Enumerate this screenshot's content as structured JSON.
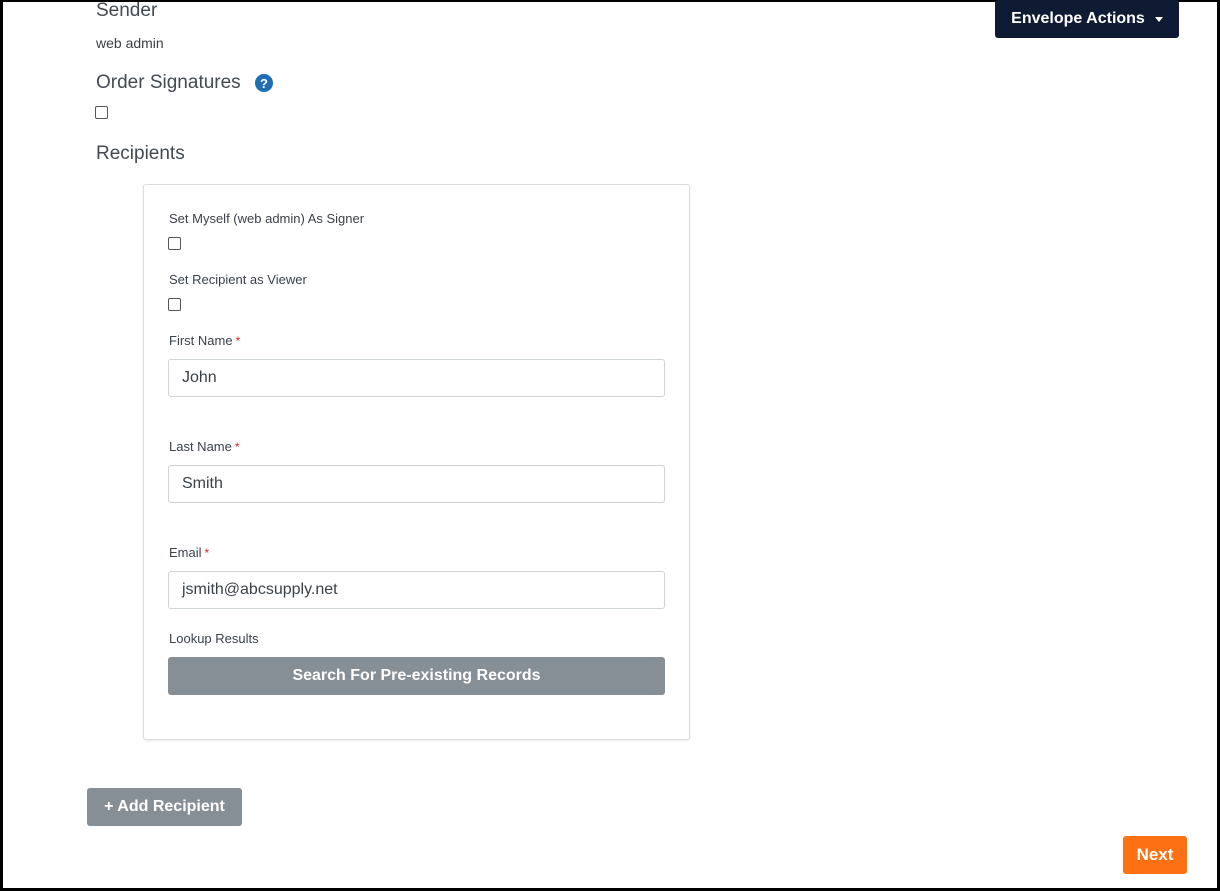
{
  "sender": {
    "title": "Sender",
    "value": "web admin"
  },
  "order_signatures": {
    "title": "Order Signatures",
    "help_icon": "?",
    "checked": false
  },
  "recipients": {
    "title": "Recipients"
  },
  "envelope_actions": {
    "label": "Envelope Actions"
  },
  "recipient_card": {
    "set_myself_label": "Set Myself (web admin) As Signer",
    "set_viewer_label": "Set Recipient as Viewer",
    "first_name": {
      "label": "First Name",
      "required_mark": "*",
      "value": "John"
    },
    "last_name": {
      "label": "Last Name",
      "required_mark": "*",
      "value": "Smith"
    },
    "email": {
      "label": "Email",
      "required_mark": "*",
      "value": "jsmith@abcsupply.net"
    },
    "lookup_label": "Lookup Results",
    "search_button": "Search For Pre-existing Records"
  },
  "add_recipient_button": "+ Add Recipient",
  "next_button": "Next",
  "colors": {
    "envelope_button": "#0f1b33",
    "help_icon": "#1f6fb2",
    "gray_button": "#868e96",
    "next_button": "#fd7014",
    "required": "#d9232e"
  }
}
